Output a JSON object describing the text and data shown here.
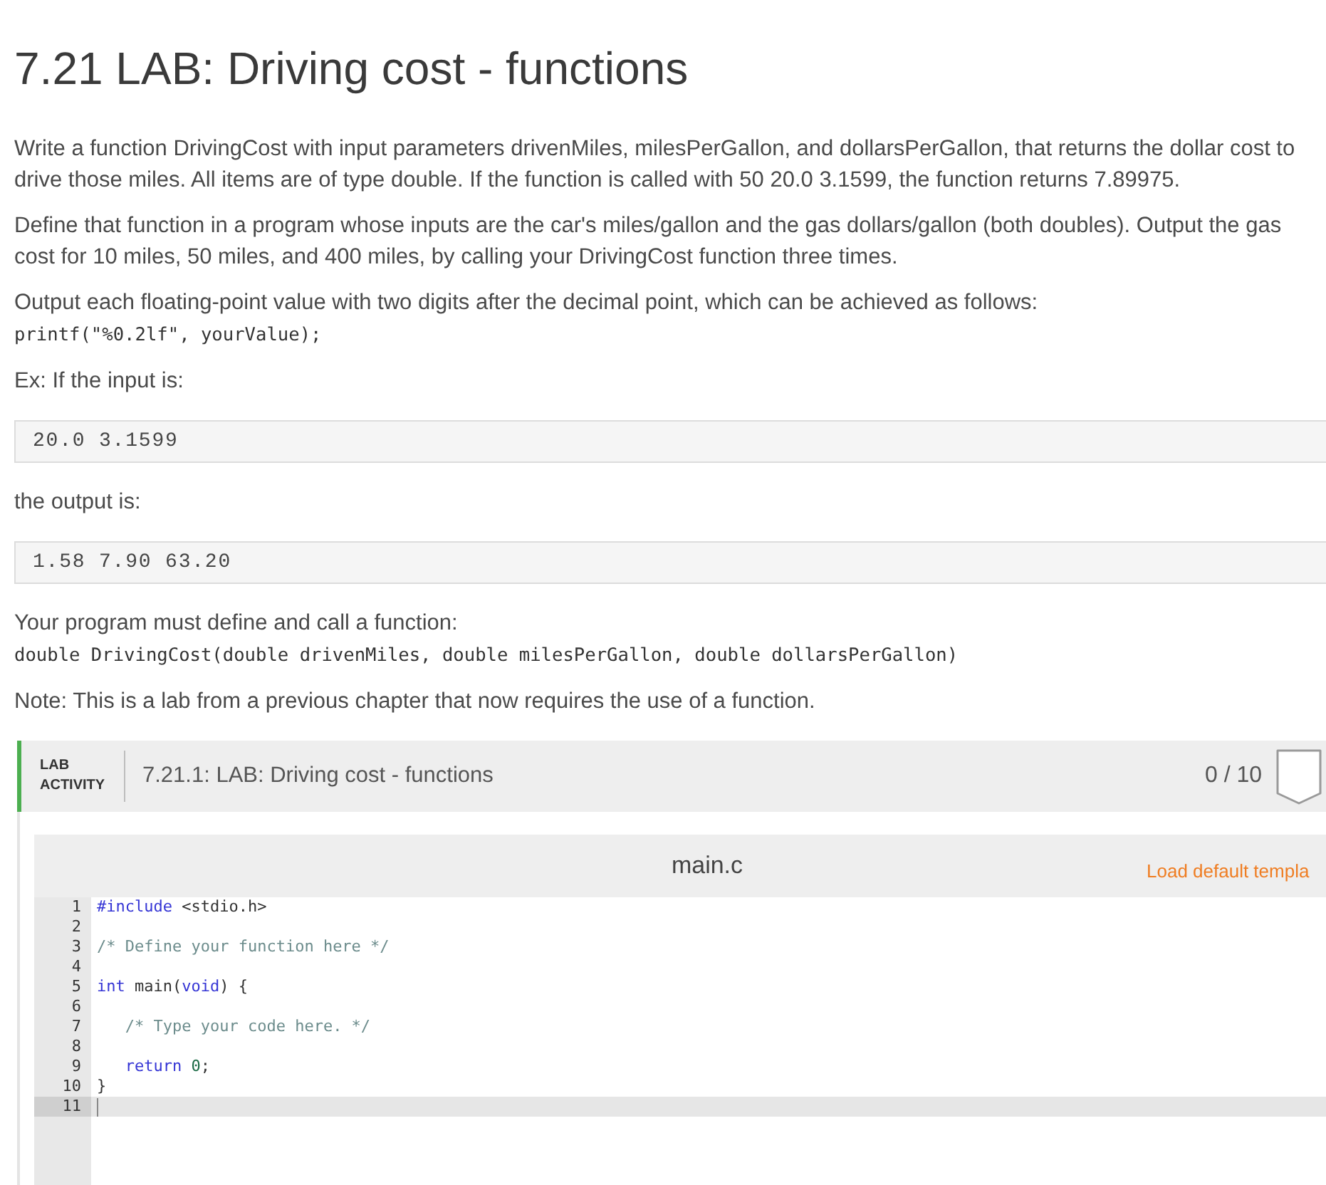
{
  "title": "7.21 LAB: Driving cost - functions",
  "content": [
    {
      "kind": "paragraph",
      "text": "Write a function DrivingCost with input parameters drivenMiles, milesPerGallon, and dollarsPerGallon, that returns the dollar cost to drive those miles. All items are of type double. If the function is called with 50 20.0 3.1599, the function returns 7.89975."
    },
    {
      "kind": "paragraph",
      "text": "Define that function in a program whose inputs are the car's miles/gallon and the gas dollars/gallon (both doubles). Output the gas cost for 10 miles, 50 miles, and 400 miles, by calling your DrivingCost function three times."
    },
    {
      "kind": "paragraph",
      "text": "Output each floating-point value with two digits after the decimal point, which can be achieved as follows:",
      "code": "printf(\"%0.2lf\", yourValue);"
    },
    {
      "kind": "paragraph",
      "text": "Ex: If the input is:"
    },
    {
      "kind": "sample",
      "text": "20.0 3.1599"
    },
    {
      "kind": "paragraph",
      "text": "the output is:"
    },
    {
      "kind": "sample",
      "text": "1.58 7.90 63.20"
    },
    {
      "kind": "paragraph",
      "text": "Your program must define and call a function:",
      "code": "double DrivingCost(double drivenMiles, double milesPerGallon, double dollarsPerGallon)"
    },
    {
      "kind": "paragraph",
      "text": "Note: This is a lab from a previous chapter that now requires the use of a function."
    }
  ],
  "lab": {
    "label": "LAB ACTIVITY",
    "title": "7.21.1: LAB: Driving cost - functions",
    "score": "0 / 10"
  },
  "editor": {
    "filename": "main.c",
    "load_link": "Load default templa",
    "lines": [
      {
        "number": "1",
        "active": false,
        "tokens": [
          {
            "kind": "keyword",
            "text": "#include"
          },
          {
            "kind": "plain",
            "text": " <stdio.h>"
          }
        ]
      },
      {
        "number": "2",
        "active": false
      },
      {
        "number": "3",
        "active": false,
        "tokens": [
          {
            "kind": "comment",
            "text": "/* Define your function here */"
          }
        ]
      },
      {
        "number": "4",
        "active": false
      },
      {
        "number": "5",
        "active": false,
        "tokens": [
          {
            "kind": "keyword",
            "text": "int"
          },
          {
            "kind": "plain",
            "text": " main("
          },
          {
            "kind": "keyword",
            "text": "void"
          },
          {
            "kind": "plain",
            "text": ") {"
          }
        ]
      },
      {
        "number": "6",
        "active": false
      },
      {
        "number": "7",
        "active": false,
        "tokens": [
          {
            "kind": "comment",
            "text": "   /* Type your code here. */"
          }
        ]
      },
      {
        "number": "8",
        "active": false
      },
      {
        "number": "9",
        "active": false,
        "tokens": [
          {
            "kind": "keyword",
            "text": "   return"
          },
          {
            "kind": "number",
            "text": " 0"
          },
          {
            "kind": "plain",
            "text": ";"
          }
        ]
      },
      {
        "number": "10",
        "active": false,
        "tokens": [
          {
            "kind": "plain",
            "text": "}"
          }
        ]
      },
      {
        "number": "11",
        "active": true
      }
    ]
  }
}
